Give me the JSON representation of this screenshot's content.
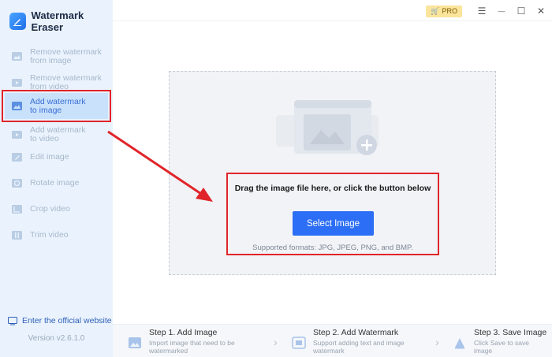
{
  "app": {
    "title": "Watermark Eraser",
    "version": "Version v2.6.1.0",
    "website_link": "Enter the official website"
  },
  "titlebar": {
    "pro_label": "PRO",
    "menu_glyph": "☰",
    "minimize_glyph": "—",
    "maximize_glyph": "☐",
    "close_glyph": "✕"
  },
  "sidebar": {
    "items": [
      {
        "label": "Remove watermark\nfrom image",
        "icon": "image-remove-icon"
      },
      {
        "label": "Remove watermark\nfrom video",
        "icon": "video-remove-icon"
      },
      {
        "label": "Add watermark\nto image",
        "icon": "image-add-icon",
        "active": true
      },
      {
        "label": "Add watermark\nto video",
        "icon": "video-add-icon"
      },
      {
        "label": "Edit image",
        "icon": "edit-image-icon"
      },
      {
        "label": "Rotate image",
        "icon": "rotate-image-icon"
      },
      {
        "label": "Crop video",
        "icon": "crop-video-icon"
      },
      {
        "label": "Trim video",
        "icon": "trim-video-icon"
      }
    ]
  },
  "dropzone": {
    "instruction": "Drag the image file here, or click the button below",
    "button_label": "Select Image",
    "formats": "Supported formats: JPG, JPEG, PNG, and BMP."
  },
  "steps": [
    {
      "title": "Step 1. Add Image",
      "desc": "Import image that need to be\nwatermarked"
    },
    {
      "title": "Step 2. Add Watermark",
      "desc": "Support adding text and image\nwatermark"
    },
    {
      "title": "Step 3. Save Image",
      "desc": "Click Save to save\nimage"
    }
  ],
  "colors": {
    "accent": "#2c6ef5",
    "highlight": "#e0252a",
    "sidebar_bg": "#eaf3fd",
    "pro_bg": "#fbe49b"
  }
}
